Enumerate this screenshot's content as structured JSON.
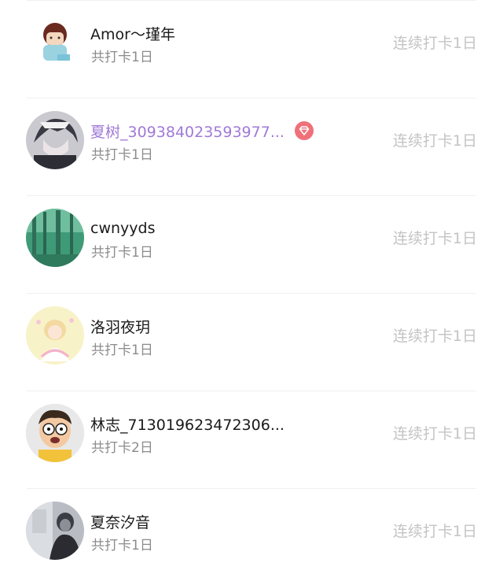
{
  "checkin_list": [
    {
      "name": "Amor～瑾年",
      "total": "共打卡1日",
      "streak": "连续打卡1日",
      "vip": false
    },
    {
      "name": "夏树_309384023593977...",
      "total": "共打卡1日",
      "streak": "连续打卡1日",
      "vip": true
    },
    {
      "name": "cwnyyds",
      "total": "共打卡1日",
      "streak": "连续打卡1日",
      "vip": false
    },
    {
      "name": "洛羽夜玥",
      "total": "共打卡1日",
      "streak": "连续打卡1日",
      "vip": false
    },
    {
      "name": "林志_713019623472306...",
      "total": "共打卡2日",
      "streak": "连续打卡1日",
      "vip": false
    },
    {
      "name": "夏奈汐音",
      "total": "共打卡1日",
      "streak": "连续打卡1日",
      "vip": false
    }
  ],
  "colors": {
    "vip_name": "#a07ad8",
    "vip_badge": "#f0707a",
    "name": "#1a1a1a",
    "total": "#8c8c8c",
    "streak": "#c4c4c4"
  },
  "icons": {
    "vip_badge": "diamond-vip-icon"
  }
}
